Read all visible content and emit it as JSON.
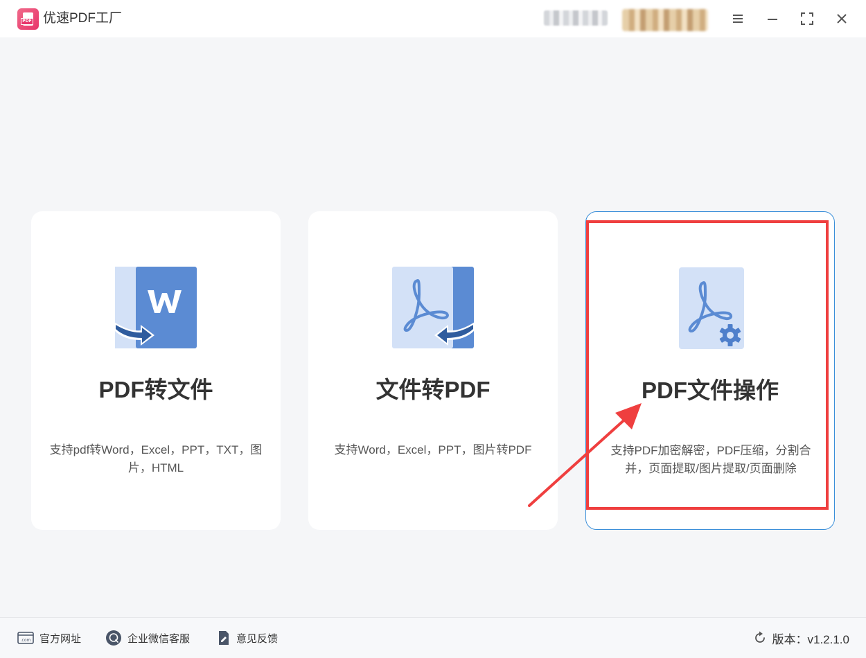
{
  "app": {
    "title": "优速PDF工厂",
    "logo_text": "PDF"
  },
  "window_controls": [
    "menu-icon",
    "minimize-icon",
    "maximize-icon",
    "close-icon"
  ],
  "cards": [
    {
      "title": "PDF转文件",
      "desc": "支持pdf转Word，Excel，PPT，TXT，图片，HTML",
      "icon": "word-convert-icon"
    },
    {
      "title": "文件转PDF",
      "desc": "支持Word，Excel，PPT，图片转PDF",
      "icon": "pdf-convert-icon"
    },
    {
      "title": "PDF文件操作",
      "desc": "支持PDF加密解密，PDF压缩，分割合并，页面提取/图片提取/页面删除",
      "icon": "pdf-gear-icon",
      "highlighted": true
    }
  ],
  "footer": {
    "website": "官方网址",
    "website_icon_text": ".com",
    "wechat": "企业微信客服",
    "feedback": "意见反馈",
    "version": "版本：v1.2.1.0"
  },
  "colors": {
    "accent": "#3b8fd9",
    "annotation": "#ef3f3f",
    "icon_blue": "#5b8bd3",
    "icon_light": "#d3e1f7",
    "icon_dark": "#2f5c9e"
  }
}
